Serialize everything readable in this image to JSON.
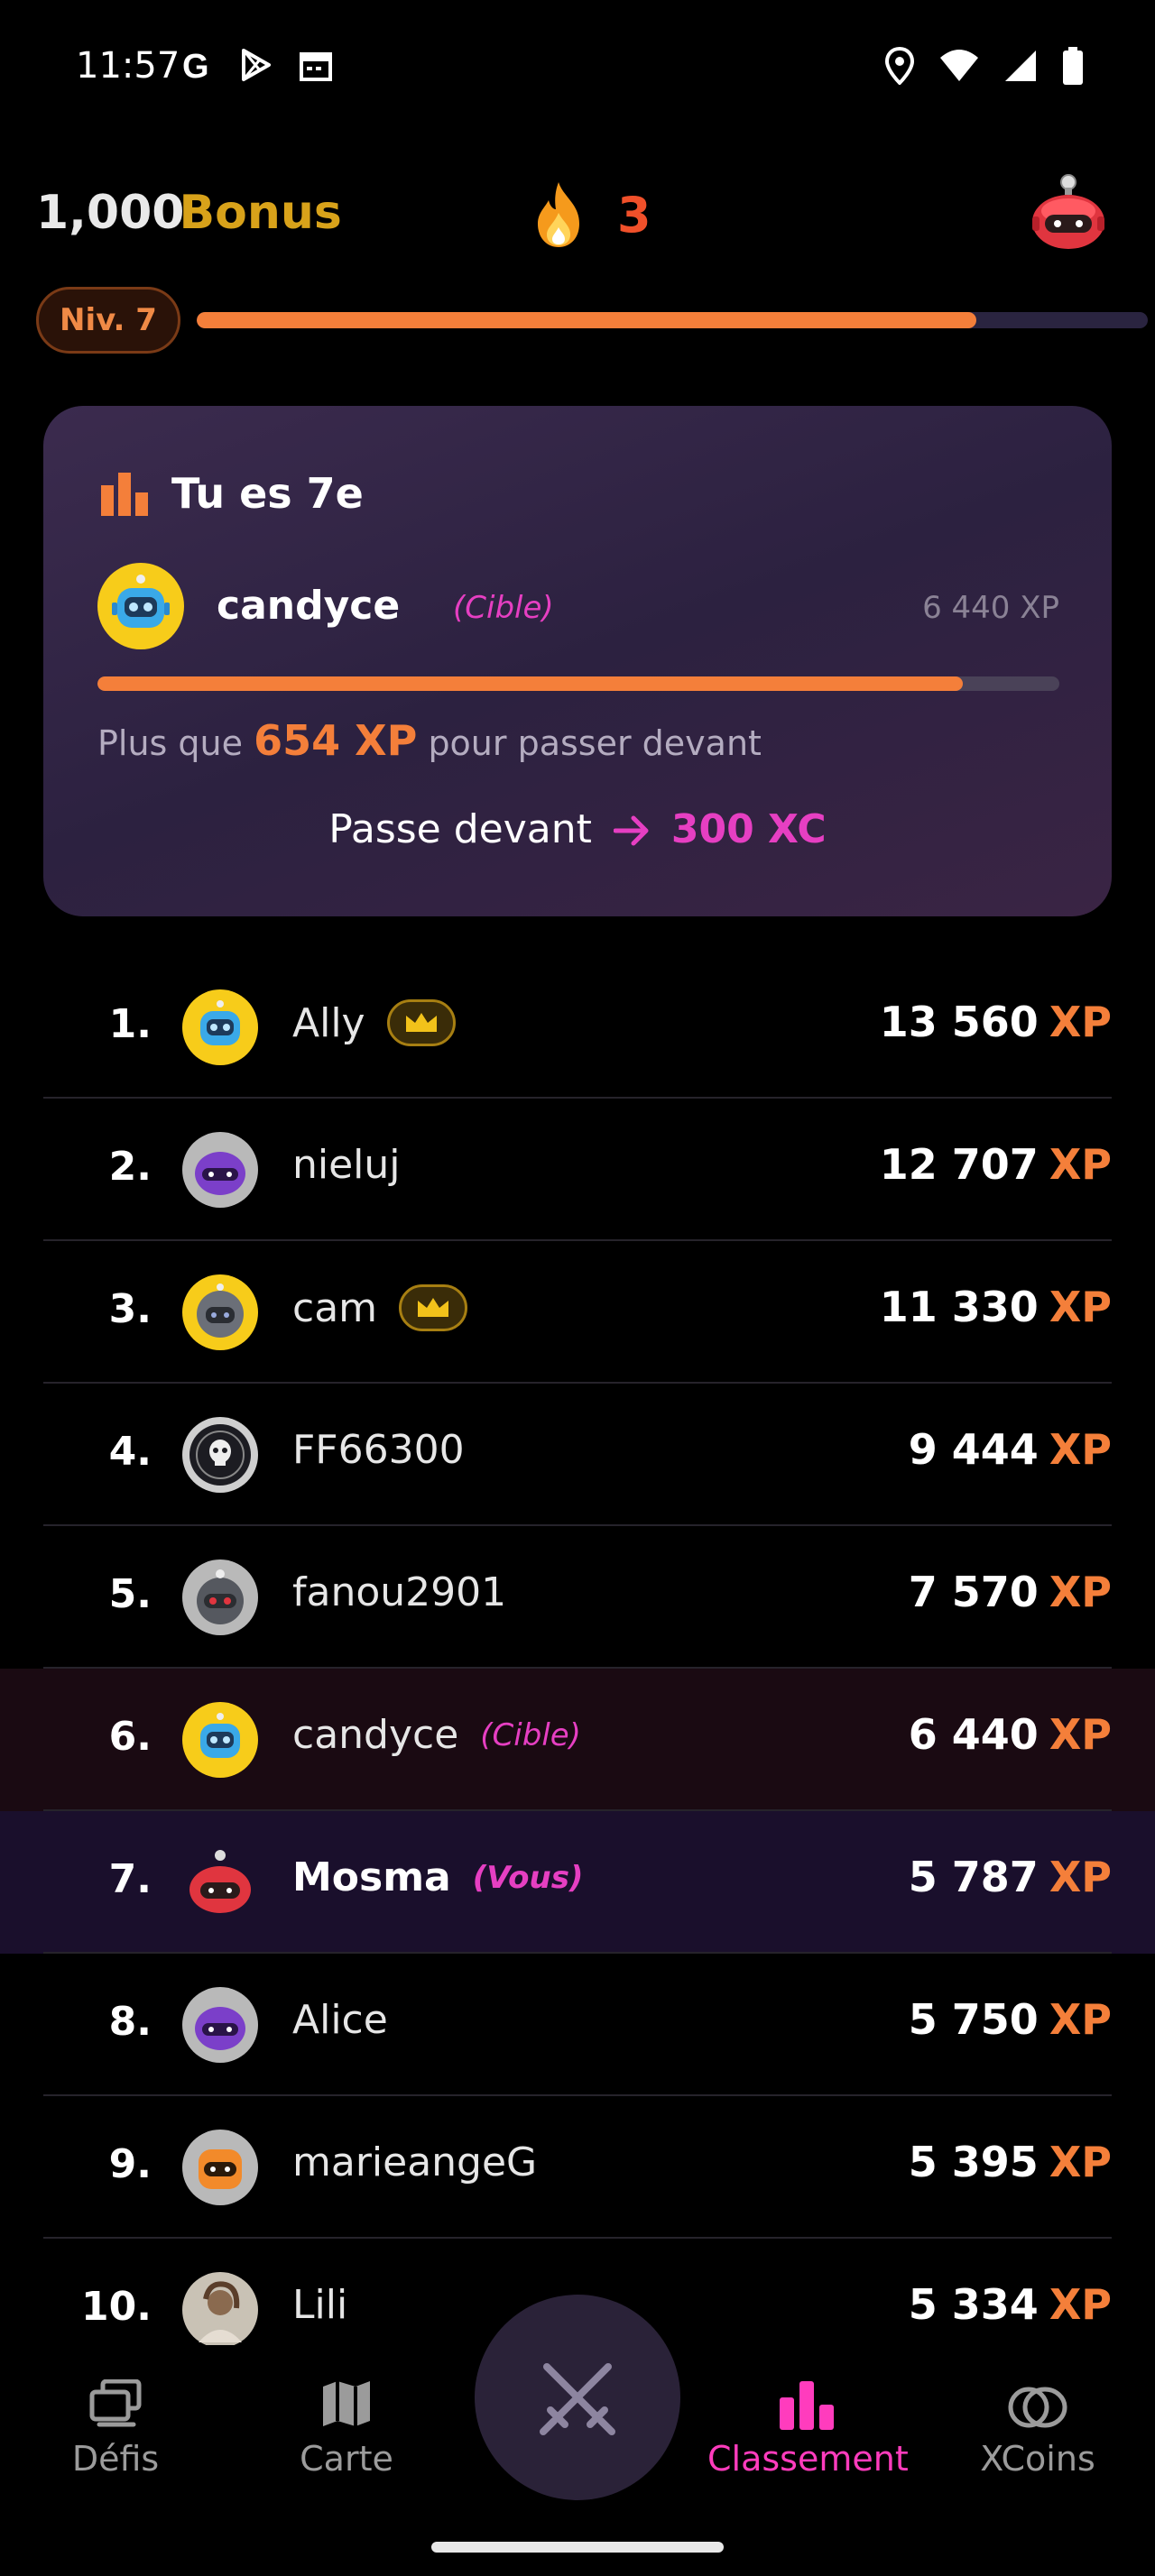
{
  "status_bar": {
    "time": "11:57"
  },
  "header": {
    "bonus_amount": "1,000",
    "bonus_label": "Bonus",
    "streak_count": "3"
  },
  "level": {
    "label": "Niv. 7",
    "progress": 0.82
  },
  "rank_card": {
    "title": "Tu es 7e",
    "target_name": "candyce",
    "target_tag": "(Cible)",
    "target_xp": "6 440 XP",
    "progress": 0.9,
    "remaining_prefix": "Plus que",
    "remaining_amount": "654 XP",
    "remaining_suffix": "pour passer devant",
    "action_label": "Passe devant",
    "action_reward": "300 XC"
  },
  "leaderboard": [
    {
      "rank": "1.",
      "name": "Ally",
      "tag": "",
      "xp": "13 560",
      "unit": "XP",
      "crown": true,
      "avatar": "robot-blue-yellow"
    },
    {
      "rank": "2.",
      "name": "nieluj",
      "tag": "",
      "xp": "12 707",
      "unit": "XP",
      "crown": false,
      "avatar": "robot-purple-grey"
    },
    {
      "rank": "3.",
      "name": "cam",
      "tag": "",
      "xp": "11 330",
      "unit": "XP",
      "crown": true,
      "avatar": "robot-grey-yellow"
    },
    {
      "rank": "4.",
      "name": "FF66300",
      "tag": "",
      "xp": "9 444",
      "unit": "XP",
      "crown": false,
      "avatar": "skull-badge"
    },
    {
      "rank": "5.",
      "name": "fanou2901",
      "tag": "",
      "xp": "7 570",
      "unit": "XP",
      "crown": false,
      "avatar": "robot-dark-grey"
    },
    {
      "rank": "6.",
      "name": "candyce",
      "tag": "(Cible)",
      "xp": "6 440",
      "unit": "XP",
      "crown": false,
      "avatar": "robot-blue-yellow"
    },
    {
      "rank": "7.",
      "name": "Mosma",
      "tag": "(Vous)",
      "xp": "5 787",
      "unit": "XP",
      "crown": false,
      "avatar": "robot-red"
    },
    {
      "rank": "8.",
      "name": "Alice",
      "tag": "",
      "xp": "5 750",
      "unit": "XP",
      "crown": false,
      "avatar": "robot-purple-grey"
    },
    {
      "rank": "9.",
      "name": "marieangeG",
      "tag": "",
      "xp": "5 395",
      "unit": "XP",
      "crown": false,
      "avatar": "robot-orange-grey"
    },
    {
      "rank": "10.",
      "name": "Lili",
      "tag": "",
      "xp": "5 334",
      "unit": "XP",
      "crown": false,
      "avatar": "photo"
    }
  ],
  "bottom_nav": {
    "items": [
      {
        "label": "Défis",
        "icon": "challenges-icon",
        "active": false
      },
      {
        "label": "Carte",
        "icon": "map-icon",
        "active": false
      },
      {
        "label": "Classement",
        "icon": "ranking-icon",
        "active": true
      },
      {
        "label": "XCoins",
        "icon": "xcoins-icon",
        "active": false
      }
    ],
    "center_icon": "crossed-swords-icon"
  },
  "colors": {
    "accent": "#f47f3a",
    "pink": "#e63fc2",
    "active_nav": "#ff3cbd",
    "gold": "#d8a21a"
  }
}
